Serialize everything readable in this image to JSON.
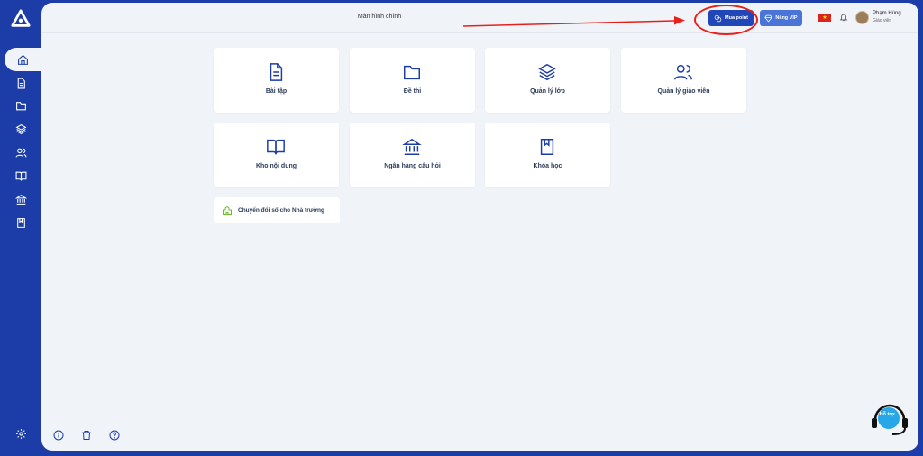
{
  "app": {
    "page_title": "Màn hình chính"
  },
  "header": {
    "buy_point_label": "Mua point",
    "vip_label": "Nâng VIP",
    "user_name": "Phạm Hùng",
    "user_role": "Giáo viên"
  },
  "sidebar": {
    "items": [
      {
        "name": "home-icon",
        "active": true
      },
      {
        "name": "document-icon"
      },
      {
        "name": "folder-icon"
      },
      {
        "name": "layers-icon"
      },
      {
        "name": "users-icon"
      },
      {
        "name": "book-open-icon"
      },
      {
        "name": "bank-icon"
      },
      {
        "name": "book-icon"
      }
    ],
    "settings_icon": "gear-icon"
  },
  "cards": [
    {
      "label": "Bài tập",
      "icon": "document-icon"
    },
    {
      "label": "Đề thi",
      "icon": "folder-icon"
    },
    {
      "label": "Quản lý lớp",
      "icon": "layers-icon"
    },
    {
      "label": "Quản lý giáo viên",
      "icon": "users-icon"
    },
    {
      "label": "Kho nội dung",
      "icon": "book-open-icon"
    },
    {
      "label": "Ngân hàng câu hỏi",
      "icon": "bank-icon"
    },
    {
      "label": "Khóa học",
      "icon": "book-icon"
    }
  ],
  "digital_transform": {
    "label": "Chuyển đổi số cho Nhà trường",
    "icon": "school-icon"
  },
  "footer_icons": [
    "info-icon",
    "trash-icon",
    "help-icon"
  ],
  "support": {
    "label": "Hỗ trợ"
  },
  "colors": {
    "brand": "#1c3ca8",
    "accent": "#2146b8",
    "vip": "#4a74d8",
    "annotation": "#e8201b",
    "background": "#f0f3f8"
  }
}
